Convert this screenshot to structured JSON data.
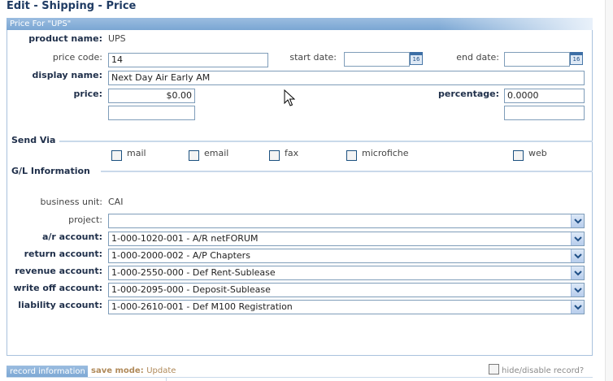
{
  "page": {
    "title": "Edit - Shipping - Price"
  },
  "panel": {
    "header": "Price For \"UPS\""
  },
  "fields": {
    "product_name": {
      "label": "product name:",
      "value": "UPS"
    },
    "price_code": {
      "label": "price code:",
      "value": "14"
    },
    "start_date": {
      "label": "start date:",
      "value": ""
    },
    "end_date": {
      "label": "end date:",
      "value": ""
    },
    "display_name": {
      "label": "display name:",
      "value": "Next Day Air Early AM"
    },
    "price": {
      "label": "price:",
      "value": "$0.00",
      "extra_value": ""
    },
    "percentage": {
      "label": "percentage:",
      "value": "0.0000",
      "extra_value": ""
    }
  },
  "calendar_icon": {
    "text": "16"
  },
  "send_via": {
    "title": "Send Via",
    "options": [
      {
        "label": "mail",
        "checked": false
      },
      {
        "label": "email",
        "checked": false
      },
      {
        "label": "fax",
        "checked": false
      },
      {
        "label": "microfiche",
        "checked": false
      },
      {
        "label": "web",
        "checked": false
      }
    ]
  },
  "gl": {
    "title": "G/L Information",
    "business_unit": {
      "label": "business unit:",
      "value": "CAI"
    },
    "project": {
      "label": "project:",
      "value": ""
    },
    "ar_account": {
      "label": "a/r account:",
      "value": "1-000-1020-001 - A/R netFORUM"
    },
    "return_account": {
      "label": "return account:",
      "value": "1-000-2000-002 - A/P Chapters"
    },
    "revenue_account": {
      "label": "revenue account:",
      "value": "1-000-2550-000 - Def Rent-Sublease"
    },
    "write_off_account": {
      "label": "write off account:",
      "value": "1-000-2095-000 - Deposit-Sublease"
    },
    "liability_account": {
      "label": "liability account:",
      "value": "1-000-2610-001 - Def M100 Registration"
    }
  },
  "footer": {
    "record_info": "record information",
    "save_mode_label": "save mode:",
    "save_mode_value": "Update",
    "hide_disable": "hide/disable record?"
  },
  "colors": {
    "header": "#7aa6d3",
    "title": "#1f3b63",
    "border": "#a9c2dd"
  }
}
